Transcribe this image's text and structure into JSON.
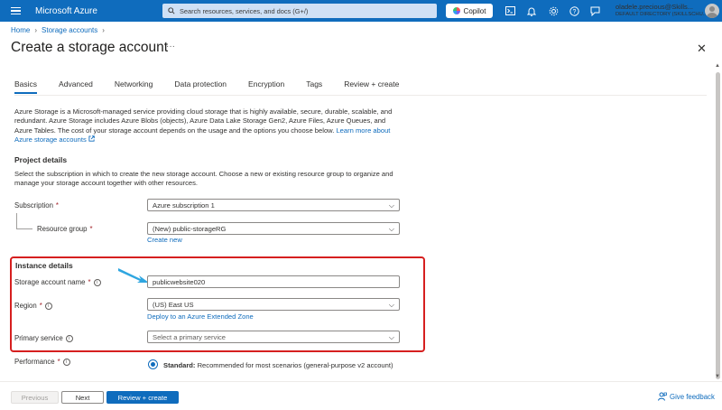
{
  "topbar": {
    "brand": "Microsoft Azure",
    "search_placeholder": "Search resources, services, and docs (G+/)",
    "copilot_label": "Copilot",
    "account_name": "oladele.precious@Skills...",
    "account_directory": "DEFAULT DIRECTORY (SKILLSCHU..."
  },
  "breadcrumb": {
    "items": [
      "Home",
      "Storage accounts"
    ]
  },
  "page": {
    "title": "Create a storage account",
    "more": "···",
    "close": "✕"
  },
  "tabs": [
    "Basics",
    "Advanced",
    "Networking",
    "Data protection",
    "Encryption",
    "Tags",
    "Review + create"
  ],
  "description": {
    "text": "Azure Storage is a Microsoft-managed service providing cloud storage that is highly available, secure, durable, scalable, and redundant. Azure Storage includes Azure Blobs (objects), Azure Data Lake Storage Gen2, Azure Files, Azure Queues, and Azure Tables. The cost of your storage account depends on the usage and the options you choose below. ",
    "link": "Learn more about Azure storage accounts"
  },
  "project_details": {
    "heading": "Project details",
    "text": "Select the subscription in which to create the new storage account. Choose a new or existing resource group to organize and manage your storage account together with other resources.",
    "subscription_label": "Subscription",
    "subscription_value": "Azure subscription 1",
    "resource_group_label": "Resource group",
    "resource_group_value": "(New) public-storageRG",
    "create_new": "Create new"
  },
  "instance_details": {
    "heading": "Instance details",
    "name_label": "Storage account name",
    "name_value": "publicwebsite020",
    "region_label": "Region",
    "region_value": "(US) East US",
    "region_link": "Deploy to an Azure Extended Zone",
    "primary_service_label": "Primary service",
    "primary_service_placeholder": "Select a primary service",
    "performance_label": "Performance",
    "performance_option_bold": "Standard:",
    "performance_option_text": " Recommended for most scenarios (general-purpose v2 account)"
  },
  "footer": {
    "previous": "Previous",
    "next": "Next",
    "review": "Review + create",
    "feedback": "Give feedback"
  },
  "colors": {
    "accent": "#0f6cbd",
    "highlight": "#d61f1f",
    "arrow": "#2fa6e0"
  }
}
